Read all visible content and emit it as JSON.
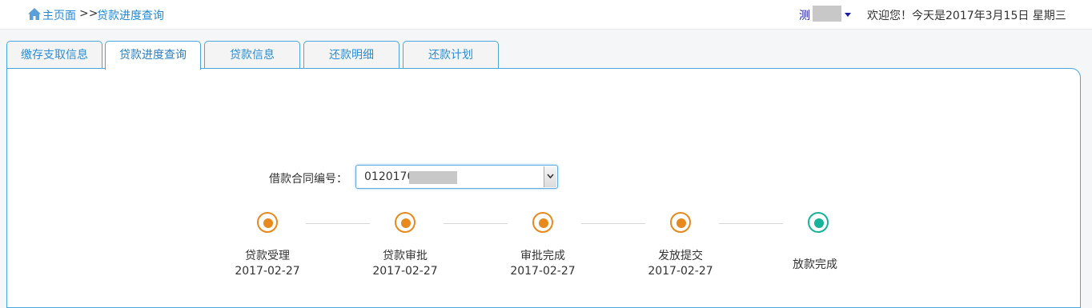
{
  "breadcrumb": {
    "home": "主页面",
    "separator": ">>",
    "current": "贷款进度查询"
  },
  "user": {
    "name_visible": "测"
  },
  "welcome_text": "欢迎您！今天是2017年3月15日 星期三",
  "tabs": [
    {
      "label": "缴存支取信息",
      "active": false
    },
    {
      "label": "贷款进度查询",
      "active": true
    },
    {
      "label": "贷款信息",
      "active": false
    },
    {
      "label": "还款明细",
      "active": false
    },
    {
      "label": "还款计划",
      "active": false
    }
  ],
  "contract": {
    "label": "借款合同编号：",
    "value_visible": "0120170"
  },
  "steps": [
    {
      "label": "贷款受理",
      "date": "2017-02-27",
      "status": "done"
    },
    {
      "label": "贷款审批",
      "date": "2017-02-27",
      "status": "done"
    },
    {
      "label": "审批完成",
      "date": "2017-02-27",
      "status": "done"
    },
    {
      "label": "发放提交",
      "date": "2017-02-27",
      "status": "done"
    },
    {
      "label": "放款完成",
      "date": "",
      "status": "current"
    }
  ],
  "colors": {
    "accent": "#1f8ad6",
    "step_done": "#e8891d",
    "step_current": "#15b39a",
    "tab_border": "#4aa6dc"
  },
  "icons": {
    "home": "home-icon",
    "user_dropdown": "caret-down-icon",
    "select_dropdown": "chevron-down-icon"
  }
}
